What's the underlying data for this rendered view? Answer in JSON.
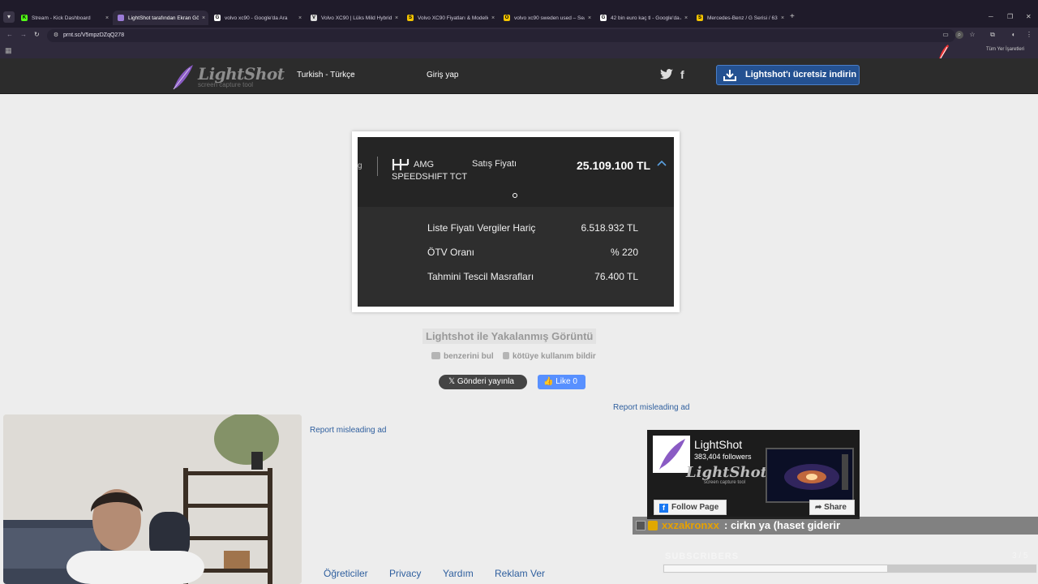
{
  "browser": {
    "tabs": [
      {
        "label": "Stream - Kick Dashboard",
        "favicon_color": "#53fc18",
        "favicon_char": "K"
      },
      {
        "label": "LightShot tarafından Ekran Görü",
        "favicon_color": "#9b7bd6",
        "favicon_char": "",
        "active": true
      },
      {
        "label": "volvo xc90 - Google'da Ara",
        "favicon_color": "#ffffff",
        "favicon_char": "G"
      },
      {
        "label": "Volvo XC90 | Lüks Mild Hybrid",
        "favicon_color": "#dddddd",
        "favicon_char": "V"
      },
      {
        "label": "Volvo XC90 Fiyatları & Modelleri",
        "favicon_color": "#f4c400",
        "favicon_char": "S"
      },
      {
        "label": "volvo xc90 sweden used – Sear",
        "favicon_color": "#f4c400",
        "favicon_char": "O"
      },
      {
        "label": "42 bin euro kaç tl - Google'da A",
        "favicon_color": "#ffffff",
        "favicon_char": "G"
      },
      {
        "label": "Mercedes-Benz / G Serisi / 63 A",
        "favicon_color": "#f4c400",
        "favicon_char": "S"
      }
    ],
    "url": "prnt.sc/V5mpzDZqQ278",
    "bookmarks_label": "Tüm Yer İşaretleri",
    "tab_close": "×",
    "new_tab": "+"
  },
  "site": {
    "logo_title": "LightShot",
    "logo_subtitle": "screen capture tool",
    "language": "Turkish - Türkçe",
    "login": "Giriş yap",
    "download": "Lightshot'ı ücretsiz indirin",
    "facebook_glyph": "f"
  },
  "screenshot": {
    "glyph": "g",
    "amg": "AMG",
    "speedshift": "SPEEDSHIFT TCT",
    "satis_label": "Satış Fiyatı",
    "price": "25.109.100 TL",
    "rows": [
      {
        "label": "Liste Fiyatı Vergiler Hariç",
        "value": "6.518.932 TL"
      },
      {
        "label": "ÖTV Oranı",
        "value": "% 220"
      },
      {
        "label": "Tahmini Tescil Masrafları",
        "value": "76.400 TL"
      }
    ]
  },
  "below": {
    "caption": "Lightshot ile Yakalanmış Görüntü",
    "find_similar": "benzerini bul",
    "report_abuse": "kötüye kullanım bildir",
    "tweet": "Gönderi yayınla",
    "like": "Like 0",
    "report_ad": "Report misleading ad"
  },
  "fb_widget": {
    "name": "LightShot",
    "followers": "383,404 followers",
    "follow": "Follow Page",
    "share": "Share",
    "logo": "LightShot",
    "logo_sub": "screen capture tool"
  },
  "stream_overlay": {
    "chat_user": "xxzakronxx",
    "chat_message": ": cirkn ya (haset giderir",
    "subscribers_label": "SUBSCRIBERS",
    "subscribers_count": "3 / 5",
    "subscribers_progress": 0.6
  },
  "footer": {
    "links": [
      "Öğreticiler",
      "Privacy",
      "Yardım",
      "Reklam Ver"
    ]
  }
}
